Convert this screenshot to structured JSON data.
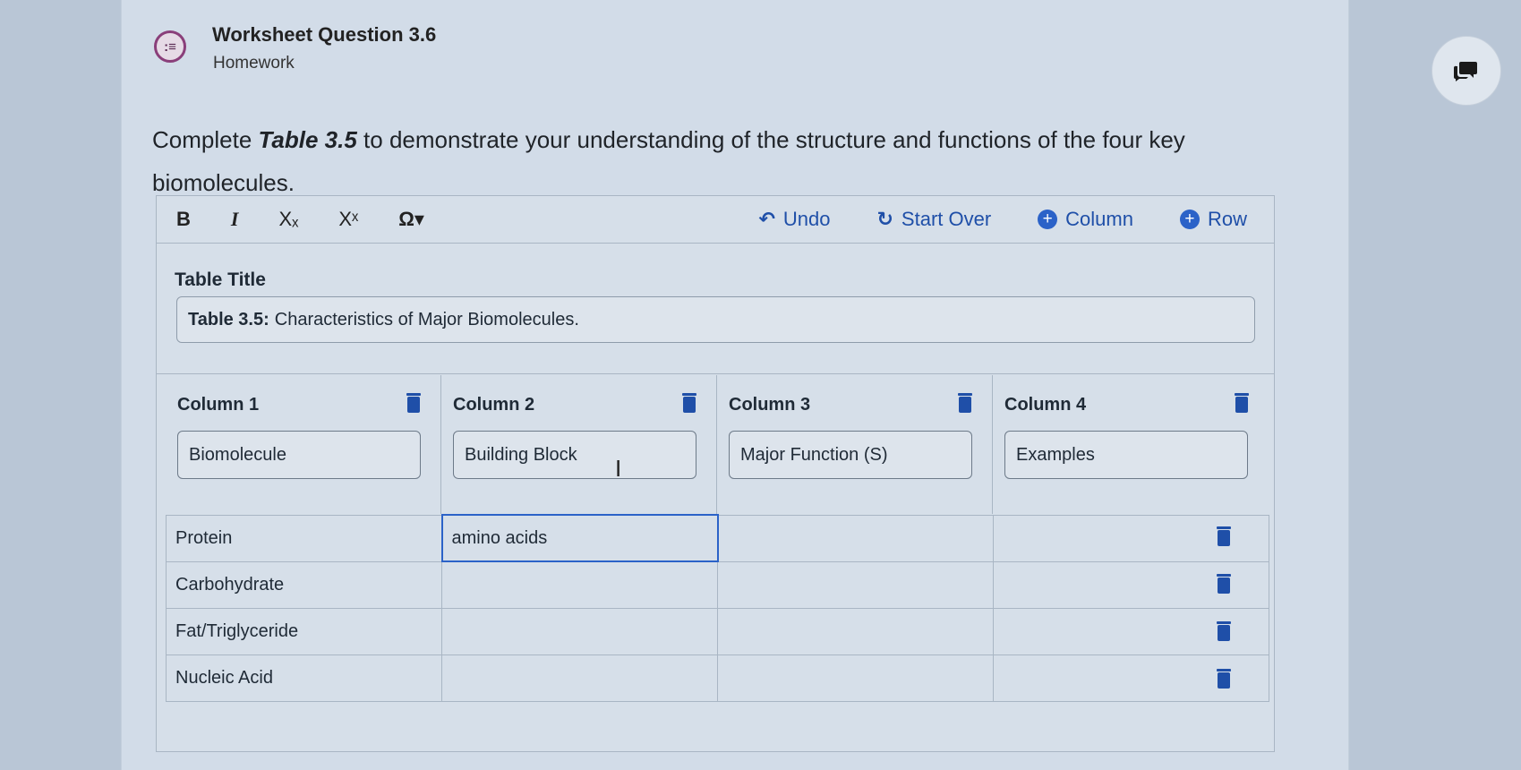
{
  "header": {
    "icon": "list-icon",
    "title": "Worksheet Question 3.6",
    "subtitle": "Homework"
  },
  "chat_button": {
    "icon": "chat-bubbles-icon"
  },
  "prompt": {
    "before": "Complete ",
    "table_ref": "Table 3.5",
    "after": " to demonstrate your understanding of the structure and functions of the four key biomolecules."
  },
  "toolbar": {
    "bold": "B",
    "italic": "I",
    "subscript": "Xₓ",
    "superscript": "Xˣ",
    "special_chars": "Ω▾",
    "undo": "Undo",
    "start_over": "Start Over",
    "add_column": "Column",
    "add_row": "Row"
  },
  "table_title": {
    "label": "Table Title",
    "prefix": "Table 3.5:",
    "value": "Characteristics of Major Biomolecules."
  },
  "columns": [
    {
      "name": "Column 1",
      "value": "Biomolecule"
    },
    {
      "name": "Column 2",
      "value": "Building Block"
    },
    {
      "name": "Column 3",
      "value": "Major Function (S)"
    },
    {
      "name": "Column 4",
      "value": "Examples"
    }
  ],
  "rows": [
    [
      "Protein",
      "amino acids",
      "",
      ""
    ],
    [
      "Carbohydrate",
      "",
      "",
      ""
    ],
    [
      "Fat/Triglyceride",
      "",
      "",
      ""
    ],
    [
      "Nucleic Acid",
      "",
      "",
      ""
    ]
  ],
  "colors": {
    "accent": "#2b62c8",
    "header_icon": "#8a3f7a",
    "trash": "#1f4fa8"
  }
}
